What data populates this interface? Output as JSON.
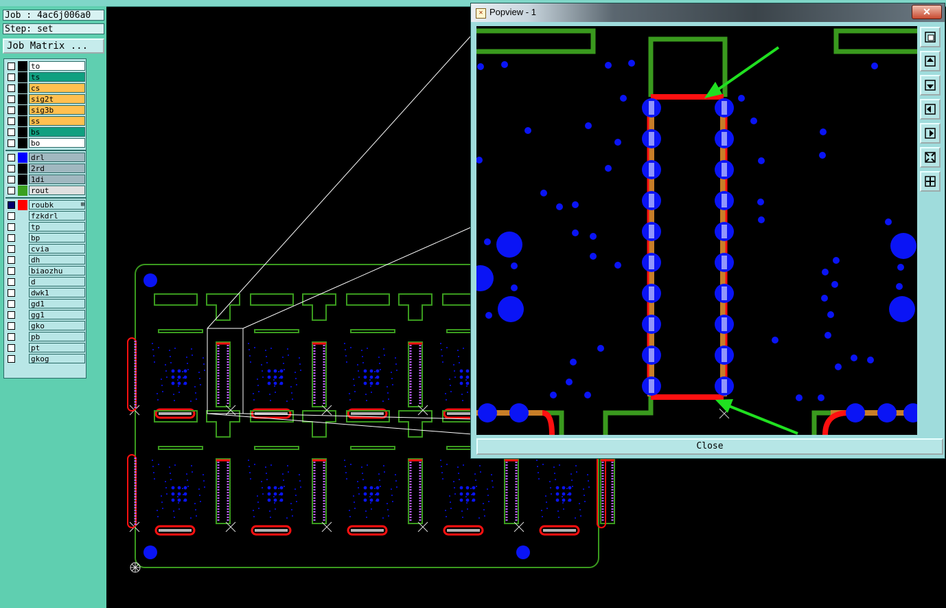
{
  "job_label": "Job : 4ac6j006a0",
  "step_label": "Step: set",
  "job_matrix_button": "Job Matrix ...",
  "layers": [
    {
      "name": "to",
      "bg": "#ffffff",
      "swatch": "#000000",
      "checked": false
    },
    {
      "name": "ts",
      "bg": "#10a080",
      "swatch": "#000000",
      "checked": false
    },
    {
      "name": "cs",
      "bg": "#ffc050",
      "swatch": "#000000",
      "checked": false
    },
    {
      "name": "sig2t",
      "bg": "#ffc050",
      "swatch": "#000000",
      "checked": false
    },
    {
      "name": "sig3b",
      "bg": "#ffc050",
      "swatch": "#000000",
      "checked": false
    },
    {
      "name": "ss",
      "bg": "#ffc050",
      "swatch": "#000000",
      "checked": false
    },
    {
      "name": "bs",
      "bg": "#10a080",
      "swatch": "#000000",
      "checked": false
    },
    {
      "name": "bo",
      "bg": "#ffffff",
      "swatch": "#000000",
      "checked": false
    },
    {
      "name": "drl",
      "bg": "#a0b8c0",
      "swatch": "#0000ff",
      "checked": false
    },
    {
      "name": "2rd",
      "bg": "#a0b8c0",
      "swatch": "#000000",
      "checked": false
    },
    {
      "name": "1di",
      "bg": "#a0b8c0",
      "swatch": "#000000",
      "checked": false
    },
    {
      "name": "rout",
      "bg": "#e0e0e0",
      "swatch": "#3aa020",
      "checked": false
    },
    {
      "name": "roubk",
      "bg": "#b8e6e6",
      "swatch": "#ff0000",
      "checked": true,
      "plus": "⊞"
    },
    {
      "name": "fzkdrl",
      "bg": "#b8e6e6",
      "swatch": "#b8e6e6",
      "checked": false
    },
    {
      "name": "tp",
      "bg": "#b8e6e6",
      "swatch": "#b8e6e6",
      "checked": false
    },
    {
      "name": "bp",
      "bg": "#b8e6e6",
      "swatch": "#b8e6e6",
      "checked": false
    },
    {
      "name": "cvia",
      "bg": "#b8e6e6",
      "swatch": "#b8e6e6",
      "checked": false
    },
    {
      "name": "dh",
      "bg": "#b8e6e6",
      "swatch": "#b8e6e6",
      "checked": false
    },
    {
      "name": "biaozhu",
      "bg": "#b8e6e6",
      "swatch": "#b8e6e6",
      "checked": false
    },
    {
      "name": "d",
      "bg": "#b8e6e6",
      "swatch": "#b8e6e6",
      "checked": false
    },
    {
      "name": "dwk1",
      "bg": "#b8e6e6",
      "swatch": "#b8e6e6",
      "checked": false
    },
    {
      "name": "gd1",
      "bg": "#b8e6e6",
      "swatch": "#b8e6e6",
      "checked": false
    },
    {
      "name": "gg1",
      "bg": "#b8e6e6",
      "swatch": "#b8e6e6",
      "checked": false
    },
    {
      "name": "gko",
      "bg": "#b8e6e6",
      "swatch": "#b8e6e6",
      "checked": false
    },
    {
      "name": "pb",
      "bg": "#b8e6e6",
      "swatch": "#b8e6e6",
      "checked": false
    },
    {
      "name": "pt",
      "bg": "#b8e6e6",
      "swatch": "#b8e6e6",
      "checked": false
    },
    {
      "name": "gkog",
      "bg": "#b8e6e6",
      "swatch": "#b8e6e6",
      "checked": false
    }
  ],
  "popup": {
    "title": "Popview - 1",
    "close_icon_glyph": "✕",
    "close_button": "Close",
    "toolbar_icons": [
      "zoom-window-icon",
      "pan-up-icon",
      "pan-down-icon",
      "pan-left-icon",
      "pan-right-icon",
      "zoom-in-icon",
      "zoom-out-icon"
    ]
  },
  "colors": {
    "rout": "#3a9a1e",
    "drill": "#0a14f5",
    "roubk": "#ff1010",
    "pad": "#c87e28",
    "arrow": "#20e020",
    "sidebar": "#5fcfb0"
  }
}
